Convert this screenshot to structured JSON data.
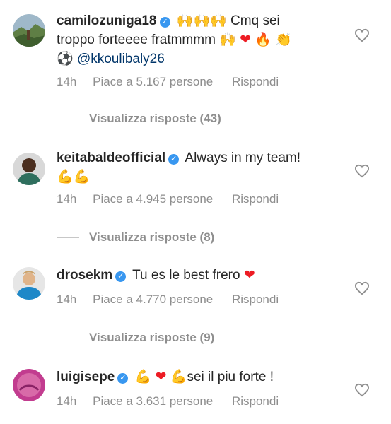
{
  "comments": [
    {
      "username": "camilozuniga18",
      "text_segments": [
        "Cmq sei",
        "troppo forteeee fratmmmm"
      ],
      "mention": "@kkoulibaly26",
      "time": "14h",
      "likes": "Piace a 5.167 persone",
      "reply": "Rispondi",
      "avatar_icon": "landscape-avatar",
      "view_replies": "Visualizza risposte (43)"
    },
    {
      "username": "keitabaldeofficial",
      "text": "Always in my team!",
      "time": "14h",
      "likes": "Piace a 4.945 persone",
      "reply": "Rispondi",
      "avatar_icon": "player-avatar",
      "view_replies": "Visualizza risposte (8)"
    },
    {
      "username": "drosekm",
      "text": "Tu es le best frero",
      "time": "14h",
      "likes": "Piace a 4.770 persone",
      "reply": "Rispondi",
      "avatar_icon": "player-avatar",
      "view_replies": "Visualizza risposte (9)"
    },
    {
      "username": "luigisepe",
      "text": "sei il piu forte !",
      "time": "14h",
      "likes": "Piace a 3.631 persone",
      "reply": "Rispondi",
      "avatar_icon": "pink-avatar"
    }
  ],
  "icons": {
    "verified": "verified-badge-icon",
    "like": "heart-outline-icon"
  },
  "colors": {
    "verified": "#3897f0",
    "secondary_text": "#8e8e8e",
    "mention": "#003569"
  }
}
